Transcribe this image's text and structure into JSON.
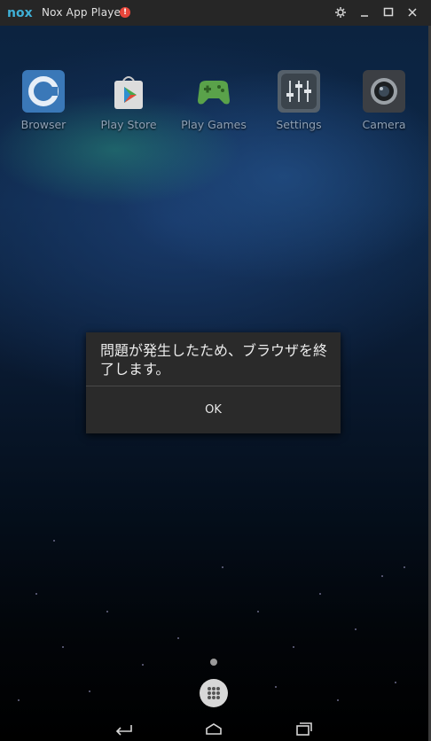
{
  "titlebar": {
    "logo_text": "nox",
    "title": "Nox App Player",
    "alert_badge": "!",
    "buttons": [
      "settings",
      "minimize",
      "maximize",
      "close"
    ]
  },
  "home_apps": [
    {
      "label": "Browser",
      "icon": "browser-icon"
    },
    {
      "label": "Play Store",
      "icon": "play-store-icon"
    },
    {
      "label": "Play Games",
      "icon": "play-games-icon"
    },
    {
      "label": "Settings",
      "icon": "settings-icon"
    },
    {
      "label": "Camera",
      "icon": "camera-icon"
    }
  ],
  "dialog": {
    "message": "問題が発生したため、ブラウザを終了します。",
    "ok_label": "OK"
  },
  "navigation": [
    "back-icon",
    "home-icon",
    "recents-icon"
  ],
  "colors": {
    "titlebar_bg": "#262626",
    "dialog_bg": "#2a2a2a",
    "alert_red": "#e8463b"
  }
}
